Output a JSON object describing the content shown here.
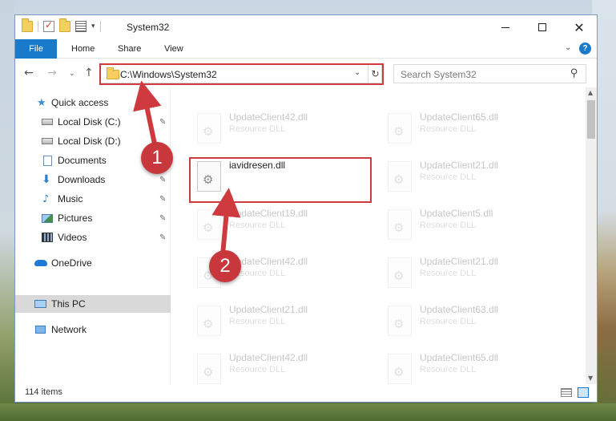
{
  "window": {
    "title": "System32",
    "minimize": "—",
    "close": "✕"
  },
  "ribbon": {
    "tabs": [
      "File",
      "Home",
      "Share",
      "View"
    ],
    "help": "?",
    "collapse": "⌃"
  },
  "navigation": {
    "back": "←",
    "forward": "→",
    "recent": "⌄",
    "up": "↑",
    "address": "C:\\Windows\\System32",
    "address_dropdown": "⌄",
    "refresh": "↻",
    "search_placeholder": "Search System32",
    "search_icon": "⚲"
  },
  "sidebar": {
    "items": [
      {
        "label": "Quick access",
        "icon": "star-icon"
      },
      {
        "label": "Local Disk (C:)",
        "icon": "drive-icon",
        "pinned": true
      },
      {
        "label": "Local Disk (D:)",
        "icon": "drive-icon",
        "pinned": true
      },
      {
        "label": "Documents",
        "icon": "documents-icon",
        "pinned": true
      },
      {
        "label": "Downloads",
        "icon": "downloads-icon",
        "pinned": true
      },
      {
        "label": "Music",
        "icon": "music-icon",
        "pinned": true
      },
      {
        "label": "Pictures",
        "icon": "pictures-icon",
        "pinned": true
      },
      {
        "label": "Videos",
        "icon": "videos-icon",
        "pinned": true
      },
      {
        "label": "OneDrive",
        "icon": "onedrive-icon"
      },
      {
        "label": "This PC",
        "icon": "pc-icon",
        "selected": true
      },
      {
        "label": "Network",
        "icon": "network-icon"
      }
    ],
    "pin_glyph": "📌"
  },
  "files": [
    {
      "name": "UpdateClient42.dll",
      "type": "Resource DLL",
      "faded": true
    },
    {
      "name": "UpdateClient65.dll",
      "type": "Resource DLL",
      "faded": true
    },
    {
      "name": "iavidresen.dll",
      "type": "",
      "faded": false
    },
    {
      "name": "UpdateClient21.dll",
      "type": "Resource DLL",
      "faded": true
    },
    {
      "name": "UpdateClient19.dll",
      "type": "Resource DLL",
      "faded": true
    },
    {
      "name": "UpdateClient5.dll",
      "type": "Resource DLL",
      "faded": true
    },
    {
      "name": "UpdateClient42.dll",
      "type": "Resource DLL",
      "faded": true
    },
    {
      "name": "UpdateClient21.dll",
      "type": "Resource DLL",
      "faded": true
    },
    {
      "name": "UpdateClient21.dll",
      "type": "Resource DLL",
      "faded": true
    },
    {
      "name": "UpdateClient63.dll",
      "type": "Resource DLL",
      "faded": true
    },
    {
      "name": "UpdateClient42.dll",
      "type": "Resource DLL",
      "faded": true
    },
    {
      "name": "UpdateClient65.dll",
      "type": "Resource DLL",
      "faded": true
    }
  ],
  "status": {
    "item_count": "114 items"
  },
  "annotations": {
    "step1": "1",
    "step2": "2",
    "color": "#cf3a3f"
  },
  "colors": {
    "accent": "#1979ca",
    "highlight": "#cf3a3f"
  }
}
